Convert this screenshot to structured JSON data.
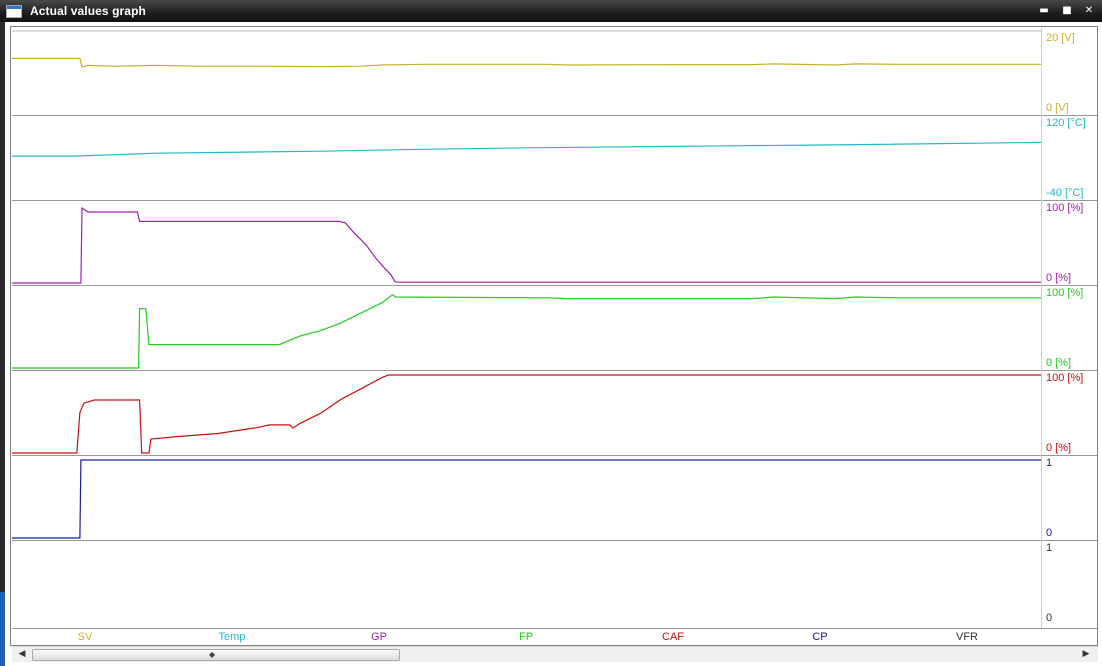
{
  "window": {
    "title": "Actual values graph",
    "controls": {
      "minimize": "▬",
      "maximize": "■",
      "close": "✕"
    }
  },
  "scroll": {
    "left_arrow": "◀",
    "right_arrow": "▶",
    "grip": "◆",
    "position_fraction": 0.0,
    "visible_fraction": 0.34
  },
  "chart_data": {
    "type": "line",
    "x_range": [
      0,
      100
    ],
    "grid": "horizontal-separators",
    "panels": [
      {
        "name": "SV",
        "color": "#c8b22a",
        "max_label": "20 [V]",
        "min_label": "0 [V]",
        "range": [
          0,
          20
        ],
        "points": [
          [
            0,
            14.0
          ],
          [
            6.6,
            14.0
          ],
          [
            6.8,
            11.8
          ],
          [
            7.4,
            12.2
          ],
          [
            10,
            12.0
          ],
          [
            14,
            12.2
          ],
          [
            18,
            12.0
          ],
          [
            24,
            12.0
          ],
          [
            30,
            11.9
          ],
          [
            34,
            12.0
          ],
          [
            36,
            12.3
          ],
          [
            40,
            12.5
          ],
          [
            52,
            12.5
          ],
          [
            54,
            12.3
          ],
          [
            66,
            12.4
          ],
          [
            72,
            12.4
          ],
          [
            74,
            12.6
          ],
          [
            80,
            12.3
          ],
          [
            82,
            12.6
          ],
          [
            86,
            12.5
          ],
          [
            100,
            12.5
          ]
        ]
      },
      {
        "name": "Temp",
        "color": "#22b8c8",
        "max_label": "120 [°C]",
        "min_label": "-40 [°C]",
        "range": [
          -40,
          120
        ],
        "points": [
          [
            0,
            46
          ],
          [
            6,
            46
          ],
          [
            14,
            52
          ],
          [
            30,
            56
          ],
          [
            40,
            60
          ],
          [
            50,
            63
          ],
          [
            60,
            65
          ],
          [
            70,
            67
          ],
          [
            80,
            69
          ],
          [
            100,
            74
          ]
        ]
      },
      {
        "name": "GP",
        "color": "#a020b0",
        "max_label": "100 [%]",
        "min_label": "0 [%]",
        "range": [
          0,
          100
        ],
        "points": [
          [
            0,
            0
          ],
          [
            6.7,
            0
          ],
          [
            6.8,
            96
          ],
          [
            7.4,
            91
          ],
          [
            12.2,
            91
          ],
          [
            12.4,
            79
          ],
          [
            31.8,
            79
          ],
          [
            32.4,
            77
          ],
          [
            33.2,
            65
          ],
          [
            34.4,
            49
          ],
          [
            35.4,
            31
          ],
          [
            36.2,
            19
          ],
          [
            36.8,
            11
          ],
          [
            37.2,
            2
          ],
          [
            37.4,
            1
          ],
          [
            100,
            1
          ]
        ]
      },
      {
        "name": "FP",
        "color": "#22cc22",
        "max_label": "100 [%]",
        "min_label": "0 [%]",
        "range": [
          0,
          100
        ],
        "points": [
          [
            0,
            0
          ],
          [
            12.3,
            0
          ],
          [
            12.4,
            76
          ],
          [
            13,
            76
          ],
          [
            13.3,
            30
          ],
          [
            20,
            30
          ],
          [
            26,
            30
          ],
          [
            26.5,
            33
          ],
          [
            28,
            41
          ],
          [
            30,
            48
          ],
          [
            32,
            58
          ],
          [
            34,
            71
          ],
          [
            36,
            84
          ],
          [
            37,
            94
          ],
          [
            37.3,
            91
          ],
          [
            52,
            90
          ],
          [
            54,
            89
          ],
          [
            72,
            89
          ],
          [
            74,
            91
          ],
          [
            80,
            89
          ],
          [
            82,
            91
          ],
          [
            86,
            90
          ],
          [
            100,
            90
          ]
        ]
      },
      {
        "name": "CAF",
        "color": "#cc1010",
        "max_label": "100 [%]",
        "min_label": "0 [%]",
        "range": [
          0,
          100
        ],
        "points": [
          [
            0,
            0
          ],
          [
            6.3,
            0
          ],
          [
            6.6,
            52
          ],
          [
            7.0,
            64
          ],
          [
            8,
            68
          ],
          [
            12.4,
            68
          ],
          [
            12.6,
            0
          ],
          [
            13.3,
            0
          ],
          [
            13.5,
            18
          ],
          [
            16,
            21
          ],
          [
            20,
            25
          ],
          [
            24,
            33
          ],
          [
            25,
            36
          ],
          [
            27,
            36
          ],
          [
            27.3,
            32
          ],
          [
            28,
            38
          ],
          [
            30,
            51
          ],
          [
            32,
            69
          ],
          [
            34,
            83
          ],
          [
            36,
            97
          ],
          [
            36.6,
            100
          ],
          [
            100,
            100
          ]
        ]
      },
      {
        "name": "CP",
        "color": "#1a1aa0",
        "max_label": "1",
        "min_label": "0",
        "range": [
          0,
          1
        ],
        "points": [
          [
            0,
            0
          ],
          [
            6.6,
            0
          ],
          [
            6.7,
            1
          ],
          [
            100,
            1
          ]
        ]
      },
      {
        "name": "VFR",
        "color": "#333333",
        "max_label": "1",
        "min_label": "0",
        "range": [
          0,
          1
        ],
        "points": []
      }
    ]
  }
}
